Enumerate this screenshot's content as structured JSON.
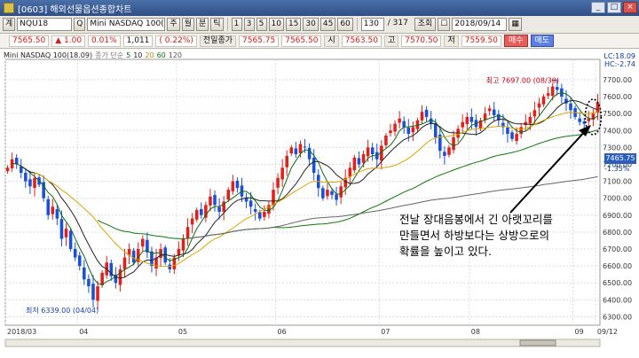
{
  "window": {
    "title": "[0603] 해외선물옵션종합차트",
    "min": "_",
    "max": "□",
    "close": "×"
  },
  "toolbar": {
    "code_label": "계",
    "code": "NQU18",
    "search": "Q",
    "name": "Mini NASDAQ 100(18.0",
    "period_buttons": [
      "주",
      "월",
      "분",
      "틱"
    ],
    "minute_buttons": [
      "1",
      "3",
      "5",
      "10",
      "15",
      "30",
      "45",
      "60"
    ],
    "count": "130",
    "ratio": "/ 317",
    "query_button": "조회",
    "date": "2018/09/14",
    "settings_icon": "calendar-icon"
  },
  "quote": {
    "price": "7565.50",
    "change": "▲ 1.00",
    "change_pct": "0.01%",
    "volume": "1,011",
    "volume_pct": "( 0.22%)",
    "session_label": "전일종가",
    "prev_close": "7565.75",
    "current": "7565.50",
    "open_label": "시",
    "open": "7563.50",
    "high_label": "고",
    "high": "7570.50",
    "low_label": "저",
    "low": "7559.50",
    "buy_button": "매수",
    "sell_button": "매도"
  },
  "legend": {
    "symbol": "Mini NASDAQ 100(18.09)",
    "type": "종가 단순",
    "ma5": "5",
    "ma10": "10",
    "ma20": "20",
    "ma60": "60",
    "ma120": "120"
  },
  "indicators": {
    "lc": "LC:18.09",
    "hc": "HC:-2.74"
  },
  "last_price_tag": "7465.75",
  "last_pct_tag": "-1.35%",
  "annotation": {
    "line1": "전날 장대음봉에서 긴 아랫꼬리를",
    "line2": "만들면서 하방보다는 상방으로의",
    "line3": "확률을 높이고 있다."
  },
  "chart_data": {
    "type": "candlestick",
    "ylim": [
      6250,
      7820
    ],
    "yticks": [
      6300,
      6400,
      6500,
      6600,
      6700,
      6800,
      6900,
      7000,
      7100,
      7200,
      7300,
      7400,
      7500,
      7600,
      7700
    ],
    "xticks": [
      {
        "label": "2018/03",
        "index": 0
      },
      {
        "label": "04",
        "index": 16
      },
      {
        "label": "05",
        "index": 38
      },
      {
        "label": "06",
        "index": 60
      },
      {
        "label": "07",
        "index": 83
      },
      {
        "label": "08",
        "index": 103
      },
      {
        "label": "09",
        "index": 126
      },
      {
        "label": "09/12",
        "index": 131
      }
    ],
    "high_annotation": {
      "text": "최고 7697.00 (08/30)",
      "index": 122,
      "value": 7697
    },
    "low_annotation": {
      "text": "최저 6339.00 (04/04)",
      "index": 19,
      "value": 6339
    },
    "closes": [
      7180,
      7230,
      7200,
      7150,
      7100,
      7070,
      7120,
      7080,
      7000,
      6900,
      6950,
      6880,
      6760,
      6820,
      6700,
      6650,
      6600,
      6520,
      6480,
      6400,
      6480,
      6560,
      6620,
      6540,
      6500,
      6580,
      6650,
      6700,
      6620,
      6700,
      6760,
      6680,
      6600,
      6650,
      6700,
      6620,
      6580,
      6650,
      6700,
      6760,
      6830,
      6880,
      6930,
      6900,
      6960,
      7010,
      6960,
      6920,
      6980,
      7050,
      7100,
      7060,
      7010,
      6980,
      6950,
      6920,
      6880,
      6920,
      6960,
      7050,
      7120,
      7180,
      7250,
      7300,
      7260,
      7320,
      7300,
      7230,
      7150,
      7060,
      7000,
      7050,
      7020,
      6990,
      7070,
      7120,
      7180,
      7240,
      7200,
      7260,
      7300,
      7260,
      7230,
      7310,
      7370,
      7400,
      7440,
      7470,
      7420,
      7380,
      7420,
      7460,
      7510,
      7480,
      7440,
      7360,
      7280,
      7250,
      7300,
      7360,
      7410,
      7450,
      7480,
      7450,
      7420,
      7460,
      7500,
      7530,
      7490,
      7460,
      7420,
      7380,
      7350,
      7380,
      7420,
      7450,
      7480,
      7520,
      7560,
      7600,
      7620,
      7660,
      7640,
      7600,
      7560,
      7520,
      7480,
      7450,
      7440,
      7470,
      7500,
      7565
    ]
  }
}
